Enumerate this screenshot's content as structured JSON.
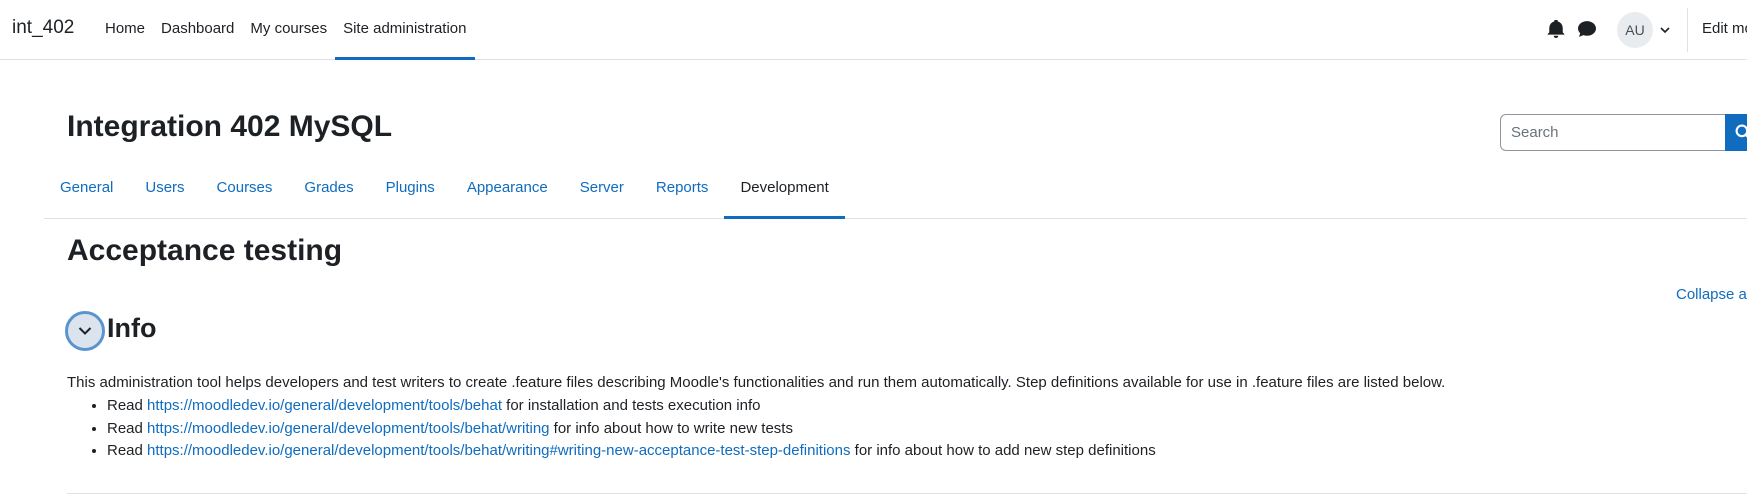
{
  "navbar": {
    "brand": "int_402",
    "items": [
      {
        "label": "Home",
        "active": false
      },
      {
        "label": "Dashboard",
        "active": false
      },
      {
        "label": "My courses",
        "active": false
      },
      {
        "label": "Site administration",
        "active": true
      }
    ],
    "icons": [
      "bell-icon",
      "chat-icon",
      "chevron-down-icon"
    ],
    "avatar_initials": "AU",
    "edit_mode_label": "Edit mo"
  },
  "header": {
    "title": "Integration 402 MySQL",
    "search": {
      "placeholder": "Search",
      "value": "",
      "button_icon": "search-icon"
    }
  },
  "tabs": [
    {
      "label": "General",
      "active": false
    },
    {
      "label": "Users",
      "active": false
    },
    {
      "label": "Courses",
      "active": false
    },
    {
      "label": "Grades",
      "active": false
    },
    {
      "label": "Plugins",
      "active": false
    },
    {
      "label": "Appearance",
      "active": false
    },
    {
      "label": "Server",
      "active": false
    },
    {
      "label": "Reports",
      "active": false
    },
    {
      "label": "Development",
      "active": true
    }
  ],
  "main": {
    "heading": "Acceptance testing",
    "collapse_all_label": "Collapse a",
    "info": {
      "heading": "Info",
      "toggle_icon": "chevron-down-icon",
      "description": "This administration tool helps developers and test writers to create .feature files describing Moodle's functionalities and run them automatically. Step definitions available for use in .feature files are listed below.",
      "items": [
        {
          "prefix": "Read",
          "link": "https://moodledev.io/general/development/tools/behat",
          "suffix": "for installation and tests execution info"
        },
        {
          "prefix": "Read",
          "link": "https://moodledev.io/general/development/tools/behat/writing",
          "suffix": "for info about how to write new tests"
        },
        {
          "prefix": "Read",
          "link": "https://moodledev.io/general/development/tools/behat/writing#writing-new-acceptance-test-step-definitions",
          "suffix": "for info about how to add new step definitions"
        }
      ]
    }
  },
  "colors": {
    "accent": "#0f6cbf",
    "text": "#1d2125",
    "border": "#dee2e6"
  }
}
